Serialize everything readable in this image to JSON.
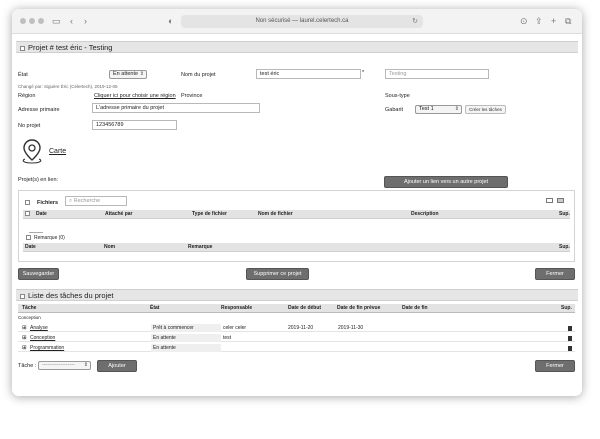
{
  "browser": {
    "url_text": "Non sécurisé — laurel.celertech.ca"
  },
  "project": {
    "header": "Projet # test éric - Testing",
    "etat_label": "État",
    "etat_value": "En attente",
    "nom_label": "Nom du projet",
    "nom_value": "test éric",
    "asterisk": "*",
    "testing_placeholder": "Testing",
    "changed_by": "Changé par: Siguère Éric (Celertech), 2019-12-05",
    "region_label": "Région",
    "region_link": "Cliquer ici pour choisir une région",
    "province_label": "Province",
    "soustype_label": "Sous-type",
    "adresse_label": "Adresse primaire",
    "adresse_value": "L'adresse primaire du projet",
    "gabarit_label": "Gabarit",
    "gabarit_value": "Test 1",
    "creer_taches_label": "Créer les tâches",
    "noprojet_label": "No projet",
    "noprojet_value": "123456789",
    "carte_label": "Carte",
    "projets_en_lien_label": "Projet(s) en lien:",
    "ajouter_lien_label": "Ajouter un lien vers un autre projet"
  },
  "files": {
    "title": "Fichiers",
    "search_placeholder": "Recherche",
    "columns": [
      "Date",
      "Attaché par",
      "Type de fichier",
      "Nom de fichier",
      "Description",
      "Sup."
    ]
  },
  "remarks": {
    "title": "Remarque (0)",
    "columns": [
      "Date",
      "Nom",
      "Remarque",
      "Sup."
    ]
  },
  "actions": {
    "save_label": "Sauvegarder",
    "delete_label": "Supprimer ce projet",
    "close_label": "Fermer"
  },
  "tasks": {
    "header": "Liste des tâches du projet",
    "columns": [
      "Tâche",
      "État",
      "Responsable",
      "Date de début",
      "Date de fin prévue",
      "Date de fin",
      "Sup."
    ],
    "group": "Conception",
    "rows": [
      {
        "name": "Analyse",
        "state": "Prêt à commencer",
        "owner": "celer celer",
        "start": "2019-11-20",
        "planned_end": "2019-11-30",
        "end": ""
      },
      {
        "name": "Conception",
        "state": "En attente",
        "owner": "test",
        "start": "",
        "planned_end": "",
        "end": ""
      },
      {
        "name": "Programmation",
        "state": "En attente",
        "owner": "",
        "start": "",
        "planned_end": "",
        "end": ""
      }
    ],
    "task_label": "Tâche :",
    "task_select_value": "------------------",
    "add_label": "Ajouter",
    "close_label": "Fermer"
  }
}
